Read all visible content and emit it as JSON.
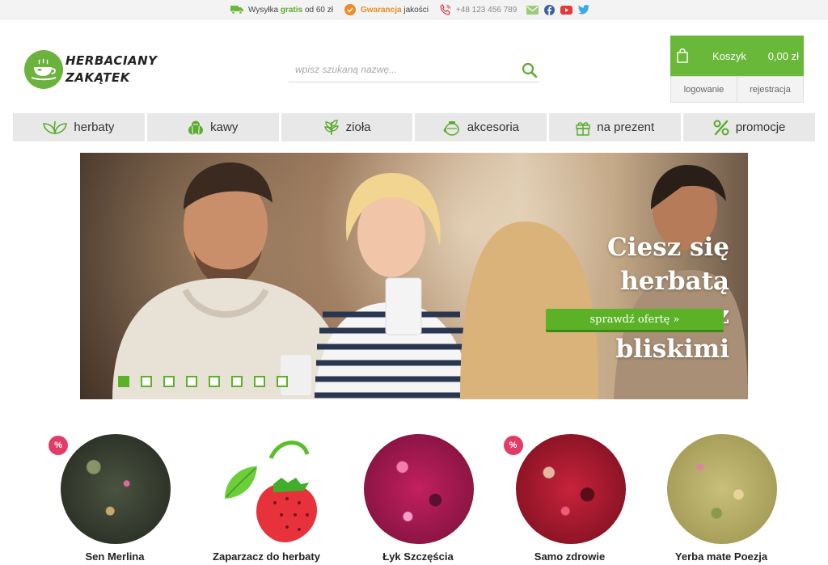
{
  "topbar": {
    "shipping_prefix": "Wysyłka",
    "shipping_highlight": "gratis",
    "shipping_suffix": "od 60 zł",
    "guarantee_highlight": "Gwarancja",
    "guarantee_suffix": "jakości",
    "phone": "+48 123 456 789",
    "social_icons": [
      "mail-icon",
      "facebook-icon",
      "youtube-icon",
      "twitter-icon"
    ]
  },
  "header": {
    "logo_line1": "HERBACIANY",
    "logo_line2": "ZAKĄTEK",
    "search_placeholder": "wpisz szukaną nazwę...",
    "cart_label": "Koszyk",
    "cart_total": "0,00 zł",
    "login_label": "logowanie",
    "register_label": "rejestracja"
  },
  "nav": {
    "items": [
      {
        "label": "herbaty",
        "icon": "tea-leaves-icon"
      },
      {
        "label": "kawy",
        "icon": "coffee-beans-icon"
      },
      {
        "label": "zioła",
        "icon": "herb-icon"
      },
      {
        "label": "akcesoria",
        "icon": "teapot-icon"
      },
      {
        "label": "na prezent",
        "icon": "gift-icon"
      },
      {
        "label": "promocje",
        "icon": "percent-icon"
      }
    ]
  },
  "hero": {
    "title_line1": "Ciesz się herbatą",
    "title_line2": "razem z bliskimi",
    "cta_label": "sprawdź ofertę »",
    "slide_count": 8,
    "active_slide": 1
  },
  "products": [
    {
      "name": "Sen Merlina",
      "promo": true,
      "badge": "%"
    },
    {
      "name": "Zaparzacz do herbaty",
      "promo": false,
      "badge": ""
    },
    {
      "name": "Łyk Szczęścia",
      "promo": false,
      "badge": ""
    },
    {
      "name": "Samo zdrowie",
      "promo": true,
      "badge": "%"
    },
    {
      "name": "Yerba mate Poezja",
      "promo": false,
      "badge": ""
    }
  ],
  "colors": {
    "brand_green": "#6ab83a",
    "promo_pink": "#e23b68",
    "guarantee_orange": "#f08a24"
  }
}
